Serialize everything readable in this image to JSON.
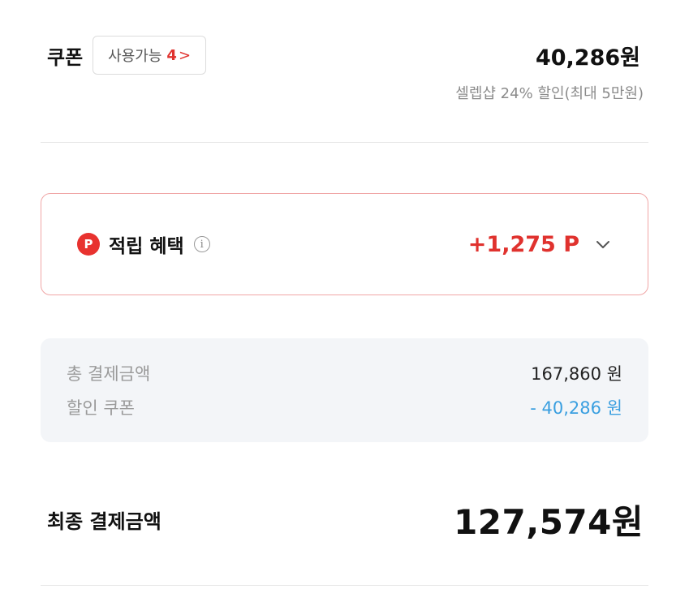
{
  "coupon": {
    "title": "쿠폰",
    "badge_label": "사용가능",
    "badge_count": "4",
    "badge_chevron": ">",
    "amount": "40,286원",
    "description": "셀렙샵 24% 할인(최대 5만원)"
  },
  "reward": {
    "icon_letter": "P",
    "label": "적립 혜택",
    "info_glyph": "i",
    "amount": "+1,275 P",
    "icon": "chevron-down-icon"
  },
  "summary": {
    "rows": [
      {
        "label": "총 결제금액",
        "value": "167,860 원"
      },
      {
        "label": "할인 쿠폰",
        "value": "- 40,286 원"
      }
    ]
  },
  "final": {
    "label": "최종 결제금액",
    "amount": "127,574원"
  },
  "colors": {
    "accent": "#e0322e",
    "discount": "#3a9fe0",
    "summary_bg": "#f3f5f8"
  }
}
